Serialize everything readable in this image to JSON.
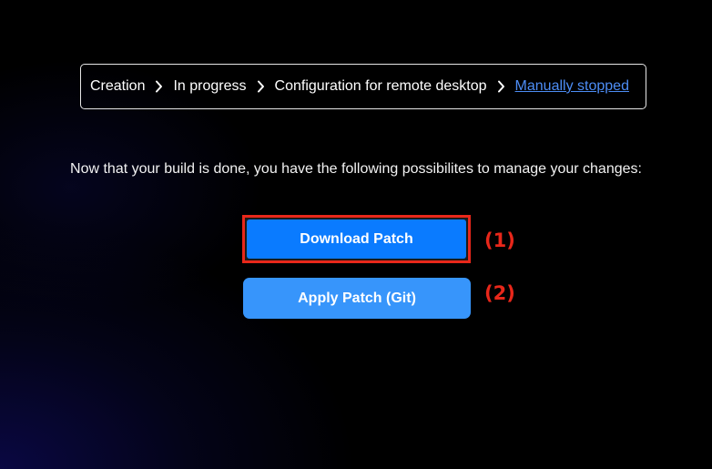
{
  "breadcrumb": {
    "items": [
      "Creation",
      "In progress",
      "Configuration for remote desktop"
    ],
    "current": "Manually stopped",
    "separator_icon": "chevron-right-icon"
  },
  "description": "Now that your build is done, you have the following possibilites to manage your changes:",
  "actions": {
    "download_label": "Download Patch",
    "apply_label": "Apply Patch (Git)"
  },
  "annotations": [
    "(1)",
    "(2)"
  ],
  "colors": {
    "primary_button": "#0a7bff",
    "secondary_button": "#3795fb",
    "link": "#4d8df5",
    "highlight": "#e8271a"
  }
}
